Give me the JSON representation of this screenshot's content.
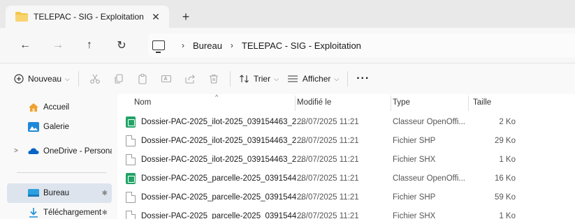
{
  "tab": {
    "title": "TELEPAC - SIG - Exploitation",
    "close_glyph": "✕",
    "new_tab_glyph": "+"
  },
  "nav": {
    "back": "←",
    "forward": "→",
    "up": "↑",
    "refresh": "↻"
  },
  "breadcrumb": {
    "items": [
      "Bureau",
      "TELEPAC - SIG - Exploitation"
    ],
    "separator": "›"
  },
  "toolbar": {
    "new_label": "Nouveau",
    "sort_label": "Trier",
    "view_label": "Afficher",
    "more_label": "···"
  },
  "sidebar": {
    "items": [
      {
        "label": "Accueil",
        "icon": "home-icon"
      },
      {
        "label": "Galerie",
        "icon": "gallery-icon"
      },
      {
        "label": "OneDrive - Persona",
        "icon": "cloud-icon"
      },
      {
        "label": "Bureau",
        "icon": "desktop-icon",
        "pinned": true
      },
      {
        "label": "Téléchargement",
        "icon": "download-icon",
        "pinned": true
      }
    ]
  },
  "columns": {
    "name": "Nom",
    "modified": "Modifié le",
    "type": "Type",
    "size": "Taille"
  },
  "files": [
    {
      "name": "Dossier-PAC-2025_ilot-2025_039154463_2...",
      "modified": "28/07/2025 11:21",
      "type": "Classeur OpenOffi...",
      "size": "2 Ko",
      "icon": "calc"
    },
    {
      "name": "Dossier-PAC-2025_ilot-2025_039154463_2...",
      "modified": "28/07/2025 11:21",
      "type": "Fichier SHP",
      "size": "29 Ko",
      "icon": "blank"
    },
    {
      "name": "Dossier-PAC-2025_ilot-2025_039154463_2...",
      "modified": "28/07/2025 11:21",
      "type": "Fichier SHX",
      "size": "1 Ko",
      "icon": "blank"
    },
    {
      "name": "Dossier-PAC-2025_parcelle-2025_0391544...",
      "modified": "28/07/2025 11:21",
      "type": "Classeur OpenOffi...",
      "size": "16 Ko",
      "icon": "calc"
    },
    {
      "name": "Dossier-PAC-2025_parcelle-2025_0391544...",
      "modified": "28/07/2025 11:21",
      "type": "Fichier SHP",
      "size": "59 Ko",
      "icon": "blank"
    },
    {
      "name": "Dossier-PAC-2025_parcelle-2025_0391544...",
      "modified": "28/07/2025 11:21",
      "type": "Fichier SHX",
      "size": "1 Ko",
      "icon": "blank"
    }
  ],
  "colors": {
    "folder": "#f4c64a",
    "selected_nav": "#dde4ee",
    "calc_green": "#21a366",
    "onedrive_blue": "#0a64c8"
  }
}
